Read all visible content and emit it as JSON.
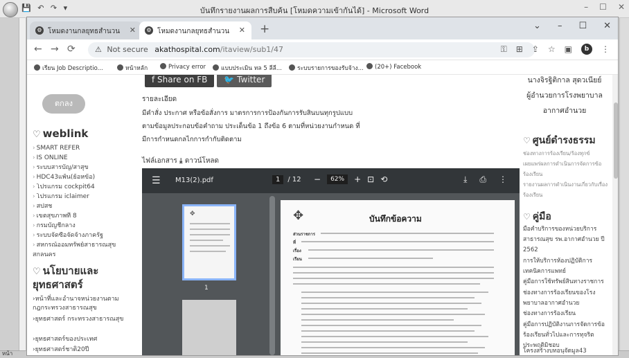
{
  "word": {
    "title": "บันทึกรายงานผลการสืบค้น [โหมดความเข้ากันได้] - Microsoft Word",
    "page_indicator": "หน้า"
  },
  "browser": {
    "tabs": [
      {
        "label": "โหมดงานกลยุทธสำนวน",
        "active": false
      },
      {
        "label": "โหมดงานกลยุทธสำนวน",
        "active": true
      }
    ],
    "address": {
      "security_label": "Not secure",
      "host": "akathospital.com",
      "path": "/itaview/sub1/47"
    },
    "profile_letter": "b",
    "bookmarks": [
      "เรียน Job Descriptio...",
      "หน้าหลัก",
      "Privacy error",
      "แบบประเมิน ทล 5 ลีลี...",
      "ระบบรายการของรับจ้าง...",
      "(20+) Facebook"
    ]
  },
  "left_nav": {
    "login_button": "ตกลง",
    "weblink_title": "weblink",
    "weblinks": [
      "SMART REFER",
      "IS ONLINE",
      "ระบบสารบัญ/สาสุข",
      "HDC43แพ้น(ย้อหข้อ)",
      "โปรแกรม cockpit64",
      "โปรแกรม iclaimer",
      "สปสช",
      "เขตสุขภาพที่ 8",
      "กรมบัญชีกลาง",
      "ระบบจัดซื้อจัดจ้างภาครัฐ",
      "สหกรณ์ออมทรัพย์สาธารณสุข"
    ],
    "weblink_tail": "สกลนคร",
    "policy_title": "นโยบายและยุทธศาสตร์",
    "policies": [
      "หน้าที่และอำนาจหน่วยงานตามกฎกระทรวงสาธารณสุข",
      "ยุทธศาสตร์ กระทรวงสาธารณสุข",
      "ยุทธศาสตร์ของประเทศ",
      "ยุทธศาสตร์ชาติ20ปี"
    ]
  },
  "content": {
    "share_fb": "Share on FB",
    "share_tw": "Twitter",
    "detail_heading": "รายละเอียด",
    "detail_lines": [
      "มีคำสั่ง ประกาศ หรือข้อสั่งการ มาตรการการป้องกันการรับสินบนทุกรูปแบบ",
      "ตามข้อมูลประกอบข้อคำถาม ประเด็นข้อ 1 ถึงข้อ 6 ตามที่หน่วยงานกำหนด ที่",
      "มีการกำหนดกลไกการกำกับติดตาม"
    ],
    "attach_label": "ไฟล์เอกสาร",
    "download_label": "ดาวน์โหลด"
  },
  "pdf": {
    "filename": "M13(2).pdf",
    "current_page": "1",
    "total_pages": "/ 12",
    "zoom": "62%",
    "thumb_page_number": "1",
    "memo_title": "บันทึกข้อความ",
    "memo_fields": [
      "ส่วนราชการ",
      "ที่",
      "เรื่อง",
      "เรียน"
    ]
  },
  "right_nav": {
    "director_name": "นางจิรฐิติกาล สุดวเนียย์",
    "director_role1": "ผู้อำนวยการโรงพยาบาล",
    "director_role2": "อากาศอำนวย",
    "service_title": "ศูนย์ดำรงธรรม",
    "service_items": [
      "ช่องทางการร้องเรียน/ร้องทุกข์",
      "เผยแพร่ผลการดำเนินการจัดการข้อร้องเรียน",
      "รายงานผลการดำเนินงานเกี่ยวกับเรื่องร้องเรียน"
    ],
    "manual_title": "คู่มือ",
    "manual_items": [
      "มือคำบริการของหน่วยบริการสาธารณสุข รพ.อากาศอำนวย ปี 2562",
      "การให้บริการห้องปฏิบัติการเทคนิคการแพทย์",
      "คู่มือการใช้ทรัพย์สินทางราชการ",
      "ช่องทางการร้องเรียนของโรงพยาบาลอากาศอำนวย",
      "ช่องทางการร้องเรียน",
      "คู่มือการปฏิบัติงานการจัดการข้อร้องเรียนทั่วไปและการทุจริตประพฤติมิชอบ",
      "โครงสร้างบทอนุจัดมูล43"
    ]
  }
}
